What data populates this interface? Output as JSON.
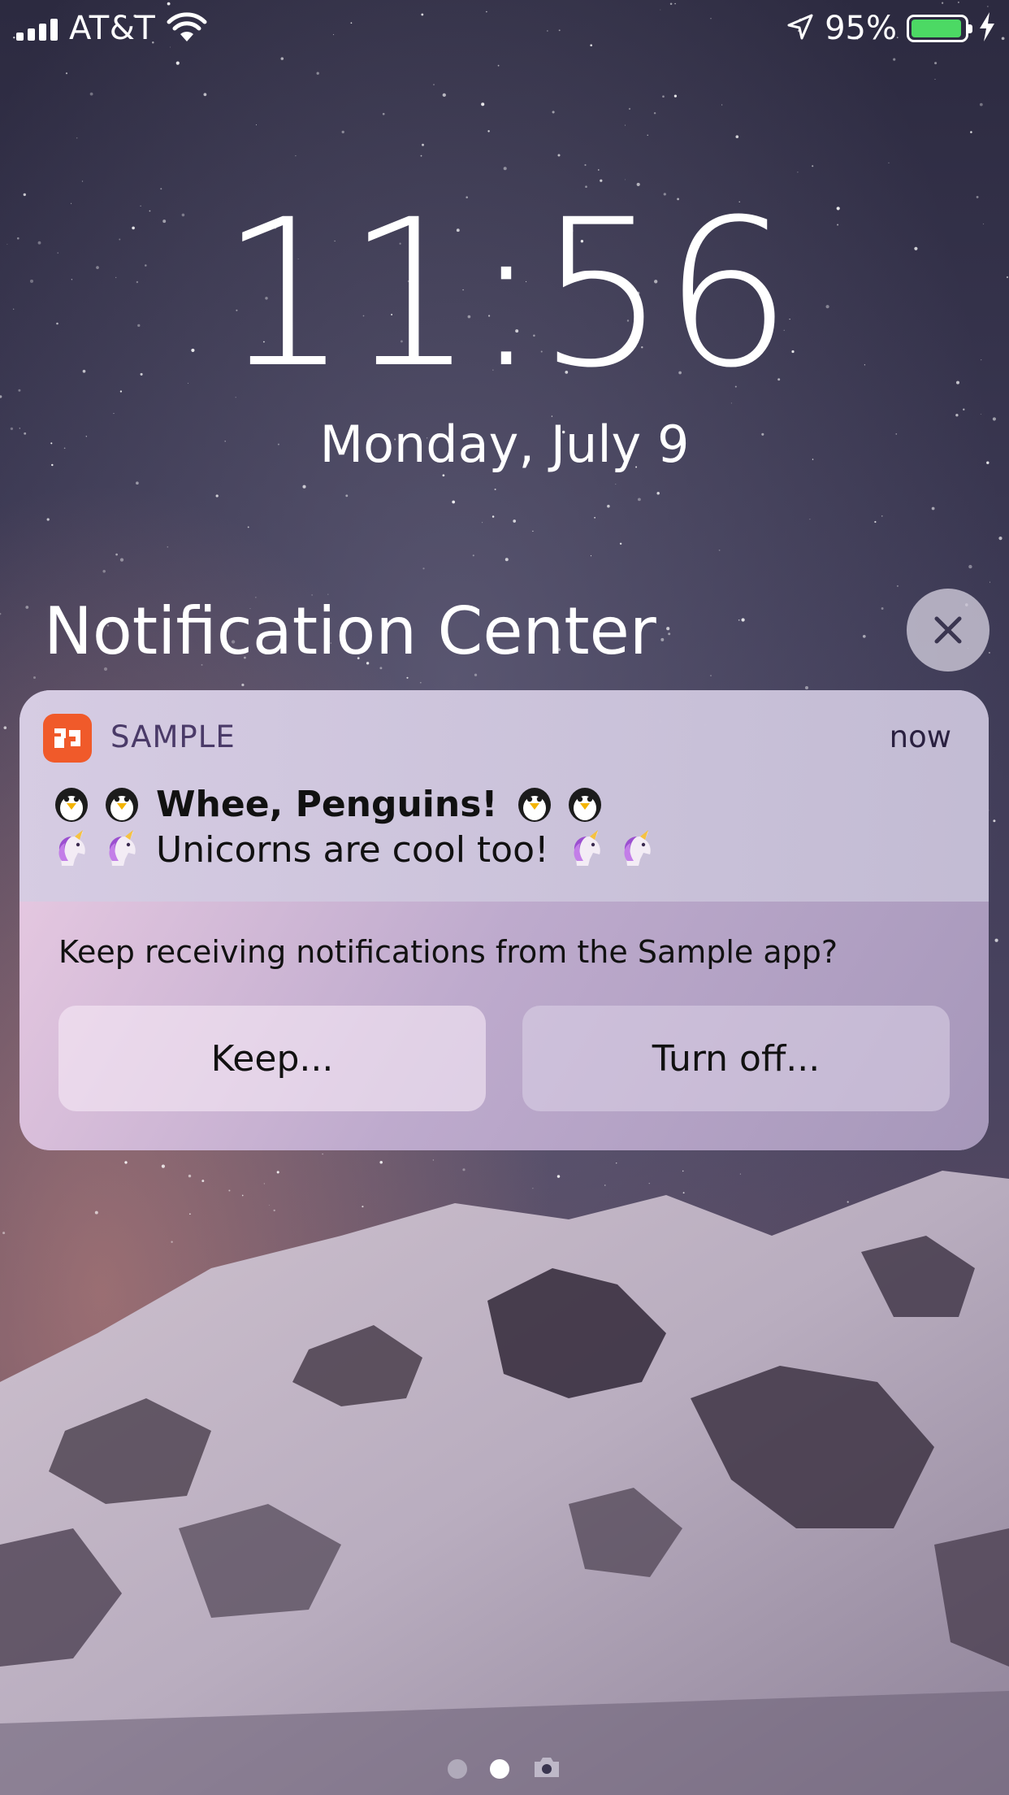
{
  "status_bar": {
    "carrier": "AT&T",
    "battery_percent": "95%",
    "battery_level": 0.95,
    "icons": [
      "signal-icon",
      "wifi-icon",
      "location-icon",
      "battery-icon",
      "charging-icon"
    ]
  },
  "lock_screen": {
    "time": "11:56",
    "date": "Monday, July 9"
  },
  "notification_center": {
    "title": "Notification Center",
    "close_icon": "close-icon"
  },
  "notification": {
    "app_name": "SAMPLE",
    "timestamp": "now",
    "title": "Whee, Penguins!",
    "body": "Unicorns are cool too!",
    "title_emoji": "penguin",
    "body_emoji": "unicorn",
    "prompt": "Keep receiving notifications from the Sample app?",
    "keep_label": "Keep...",
    "turn_off_label": "Turn off...",
    "accent_color": "#f05a2a"
  },
  "pager": {
    "pages": 3,
    "active_index": 1,
    "last_icon": "camera-icon"
  }
}
